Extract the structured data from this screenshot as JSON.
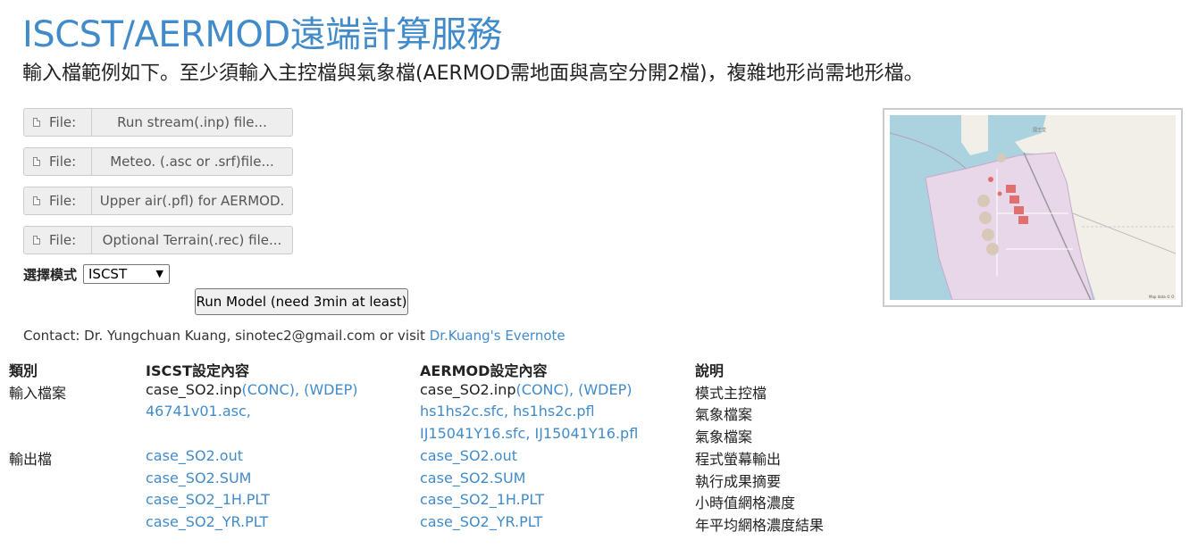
{
  "header": {
    "title": "ISCST/AERMOD遠端計算服務",
    "subtitle": "輸入檔範例如下。至少須輸入主控檔與氣象檔(AERMOD需地面與高空分開2檔)，複雜地形尚需地形檔。"
  },
  "files": [
    {
      "prefix": "File:",
      "placeholder": "Run stream(.inp) file..."
    },
    {
      "prefix": "File:",
      "placeholder": "Meteo. (.asc or .srf)file..."
    },
    {
      "prefix": "File:",
      "placeholder": "Upper air(.pfl) for AERMOD."
    },
    {
      "prefix": "File:",
      "placeholder": "Optional Terrain(.rec) file..."
    }
  ],
  "mode": {
    "label": "選擇模式",
    "selected": "ISCST"
  },
  "run_button": "Run Model (need 3min at least)",
  "contact": {
    "text": "Contact: Dr. Yungchuan Kuang, sinotec2@gmail.com or visit ",
    "link": "Dr.Kuang's Evernote"
  },
  "map": {
    "water_color": "#aad3df",
    "land_color": "#e8d7e8",
    "place_label": "國王堂",
    "attribution": "Map data © O"
  },
  "table": {
    "headers": [
      "類別",
      "ISCST設定內容",
      "AERMOD設定內容",
      "說明"
    ],
    "rows": [
      {
        "category": "輸入檔案",
        "iscst": {
          "base": "case_SO2.inp",
          "links": "(CONC), (WDEP)"
        },
        "aermod": {
          "base": "case_SO2.inp",
          "links": "(CONC), (WDEP)"
        },
        "desc": "模式主控檔"
      },
      {
        "category": "",
        "iscst": {
          "base": "",
          "links": "46741v01.asc,"
        },
        "aermod": {
          "base": "",
          "links": "hs1hs2c.sfc, hs1hs2c.pfl"
        },
        "desc": "氣象檔案"
      },
      {
        "category": "",
        "iscst": {
          "base": "",
          "links": ""
        },
        "aermod": {
          "base": "",
          "links": "IJ15041Y16.sfc, IJ15041Y16.pfl"
        },
        "desc": "氣象檔案"
      },
      {
        "category": "輸出檔",
        "iscst": {
          "base": "",
          "links": "case_SO2.out"
        },
        "aermod": {
          "base": "",
          "links": "case_SO2.out"
        },
        "desc": "程式螢幕輸出"
      },
      {
        "category": "",
        "iscst": {
          "base": "",
          "links": "case_SO2.SUM"
        },
        "aermod": {
          "base": "",
          "links": "case_SO2.SUM"
        },
        "desc": "執行成果摘要"
      },
      {
        "category": "",
        "iscst": {
          "base": "",
          "links": "case_SO2_1H.PLT"
        },
        "aermod": {
          "base": "",
          "links": "case_SO2_1H.PLT"
        },
        "desc": "小時值網格濃度"
      },
      {
        "category": "",
        "iscst": {
          "base": "",
          "links": "case_SO2_YR.PLT"
        },
        "aermod": {
          "base": "",
          "links": "case_SO2_YR.PLT"
        },
        "desc": "年平均網格濃度結果"
      }
    ]
  }
}
